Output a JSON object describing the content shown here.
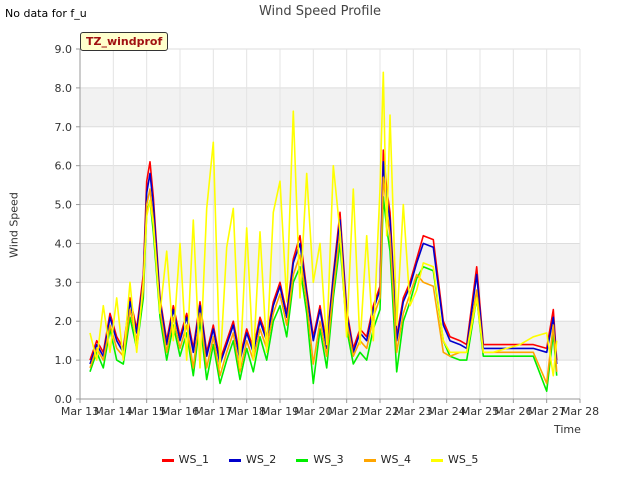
{
  "header": {
    "no_data_note": "No data for f_u",
    "tag_label": "TZ_windprof"
  },
  "chart_data": {
    "type": "line",
    "title": "Wind Speed Profile",
    "xlabel": "Time",
    "ylabel": "Wind Speed",
    "ylim": [
      0,
      9
    ],
    "yticks": [
      "0.0",
      "1.0",
      "2.0",
      "3.0",
      "4.0",
      "5.0",
      "6.0",
      "7.0",
      "8.0",
      "9.0"
    ],
    "xlim": [
      13,
      28
    ],
    "xticks": [
      "Mar 13",
      "Mar 14",
      "Mar 15",
      "Mar 16",
      "Mar 17",
      "Mar 18",
      "Mar 19",
      "Mar 20",
      "Mar 21",
      "Mar 22",
      "Mar 23",
      "Mar 24",
      "Mar 25",
      "Mar 26",
      "Mar 27",
      "Mar 28"
    ],
    "grid": true,
    "legend_position": "bottom",
    "series": [
      {
        "name": "WS_1",
        "color": "#ff0000",
        "x": [
          13.3,
          13.5,
          13.7,
          13.9,
          14.1,
          14.3,
          14.5,
          14.7,
          14.9,
          15.0,
          15.1,
          15.2,
          15.4,
          15.6,
          15.8,
          16.0,
          16.2,
          16.4,
          16.6,
          16.8,
          17.0,
          17.2,
          17.4,
          17.6,
          17.8,
          18.0,
          18.2,
          18.4,
          18.6,
          18.8,
          19.0,
          19.2,
          19.4,
          19.6,
          19.8,
          20.0,
          20.2,
          20.4,
          20.6,
          20.8,
          21.0,
          21.2,
          21.4,
          21.6,
          21.8,
          22.0,
          22.1,
          22.2,
          22.3,
          22.5,
          22.7,
          22.9,
          23.1,
          23.3,
          23.6,
          23.9,
          24.1,
          24.4,
          24.6,
          24.9,
          25.1,
          25.4,
          25.8,
          26.2,
          26.6,
          27.0,
          27.2,
          27.3
        ],
        "y": [
          1.0,
          1.5,
          1.2,
          2.2,
          1.6,
          1.3,
          2.6,
          1.8,
          3.2,
          5.6,
          6.1,
          5.2,
          2.6,
          1.5,
          2.4,
          1.6,
          2.2,
          1.3,
          2.5,
          1.2,
          1.9,
          1.0,
          1.5,
          2.0,
          1.1,
          1.8,
          1.3,
          2.1,
          1.6,
          2.5,
          3.0,
          2.2,
          3.6,
          4.2,
          2.8,
          1.6,
          2.4,
          1.4,
          3.2,
          4.8,
          2.3,
          1.3,
          1.8,
          1.6,
          2.4,
          2.9,
          6.4,
          5.4,
          4.8,
          1.6,
          2.6,
          3.0,
          3.6,
          4.2,
          4.1,
          2.0,
          1.6,
          1.5,
          1.4,
          3.4,
          1.4,
          1.4,
          1.4,
          1.4,
          1.4,
          1.3,
          2.3,
          1.0
        ]
      },
      {
        "name": "WS_2",
        "color": "#0000cc",
        "x": [
          13.3,
          13.5,
          13.7,
          13.9,
          14.1,
          14.3,
          14.5,
          14.7,
          14.9,
          15.0,
          15.1,
          15.2,
          15.4,
          15.6,
          15.8,
          16.0,
          16.2,
          16.4,
          16.6,
          16.8,
          17.0,
          17.2,
          17.4,
          17.6,
          17.8,
          18.0,
          18.2,
          18.4,
          18.6,
          18.8,
          19.0,
          19.2,
          19.4,
          19.6,
          19.8,
          20.0,
          20.2,
          20.4,
          20.6,
          20.8,
          21.0,
          21.2,
          21.4,
          21.6,
          21.8,
          22.0,
          22.1,
          22.2,
          22.3,
          22.5,
          22.7,
          22.9,
          23.1,
          23.3,
          23.6,
          23.9,
          24.1,
          24.4,
          24.6,
          24.9,
          25.1,
          25.4,
          25.8,
          26.2,
          26.6,
          27.0,
          27.2,
          27.3
        ],
        "y": [
          0.9,
          1.4,
          1.1,
          2.1,
          1.5,
          1.2,
          2.5,
          1.7,
          3.0,
          5.3,
          5.8,
          5.0,
          2.5,
          1.4,
          2.3,
          1.5,
          2.1,
          1.2,
          2.4,
          1.1,
          1.8,
          0.9,
          1.4,
          1.9,
          1.0,
          1.7,
          1.2,
          2.0,
          1.5,
          2.4,
          2.9,
          2.1,
          3.5,
          4.0,
          2.7,
          1.5,
          2.3,
          1.3,
          3.1,
          4.6,
          2.2,
          1.2,
          1.7,
          1.5,
          2.3,
          2.8,
          6.1,
          5.2,
          4.6,
          1.5,
          2.5,
          2.9,
          3.5,
          4.0,
          3.9,
          1.9,
          1.5,
          1.4,
          1.3,
          3.2,
          1.3,
          1.3,
          1.3,
          1.3,
          1.3,
          1.2,
          2.1,
          0.9
        ]
      },
      {
        "name": "WS_3",
        "color": "#00ee00",
        "x": [
          13.3,
          13.5,
          13.7,
          13.9,
          14.1,
          14.3,
          14.5,
          14.7,
          14.9,
          15.0,
          15.1,
          15.2,
          15.4,
          15.6,
          15.8,
          16.0,
          16.2,
          16.4,
          16.6,
          16.8,
          17.0,
          17.2,
          17.4,
          17.6,
          17.8,
          18.0,
          18.2,
          18.4,
          18.6,
          18.8,
          19.0,
          19.2,
          19.4,
          19.6,
          19.8,
          20.0,
          20.2,
          20.4,
          20.6,
          20.8,
          21.0,
          21.2,
          21.4,
          21.6,
          21.8,
          22.0,
          22.1,
          22.2,
          22.3,
          22.5,
          22.7,
          22.9,
          23.1,
          23.3,
          23.6,
          23.9,
          24.1,
          24.4,
          24.6,
          24.9,
          25.1,
          25.4,
          25.8,
          26.2,
          26.6,
          27.0,
          27.2,
          27.3
        ],
        "y": [
          0.7,
          1.2,
          0.8,
          1.8,
          1.0,
          0.9,
          2.1,
          1.3,
          2.6,
          4.8,
          5.1,
          4.3,
          2.1,
          1.0,
          1.9,
          1.1,
          1.7,
          0.6,
          2.0,
          0.5,
          1.4,
          0.4,
          1.0,
          1.5,
          0.5,
          1.3,
          0.7,
          1.6,
          1.0,
          2.0,
          2.4,
          1.6,
          3.0,
          3.4,
          2.2,
          0.4,
          1.8,
          0.8,
          2.6,
          4.0,
          1.8,
          0.9,
          1.2,
          1.0,
          1.8,
          2.3,
          5.2,
          4.4,
          3.8,
          0.7,
          2.0,
          2.5,
          3.1,
          3.4,
          3.3,
          1.5,
          1.1,
          1.0,
          1.0,
          2.6,
          1.1,
          1.1,
          1.1,
          1.1,
          1.1,
          0.2,
          1.7,
          0.6
        ]
      },
      {
        "name": "WS_4",
        "color": "#ffa500",
        "x": [
          13.3,
          13.5,
          13.7,
          13.9,
          14.1,
          14.3,
          14.5,
          14.7,
          14.9,
          15.0,
          15.1,
          15.2,
          15.4,
          15.6,
          15.8,
          16.0,
          16.2,
          16.4,
          16.6,
          16.8,
          17.0,
          17.2,
          17.4,
          17.6,
          17.8,
          18.0,
          18.2,
          18.4,
          18.6,
          18.8,
          19.0,
          19.2,
          19.4,
          19.6,
          19.8,
          20.0,
          20.2,
          20.4,
          20.6,
          20.8,
          21.0,
          21.2,
          21.4,
          21.6,
          21.8,
          22.0,
          22.1,
          22.2,
          22.3,
          22.5,
          22.7,
          22.9,
          23.1,
          23.3,
          23.6,
          23.9,
          24.1,
          24.4,
          24.6,
          24.9,
          25.1,
          25.4,
          25.8,
          26.2,
          26.6,
          27.0,
          27.2,
          27.3
        ],
        "y": [
          0.8,
          1.3,
          1.0,
          1.9,
          1.3,
          1.1,
          2.3,
          1.5,
          2.8,
          5.0,
          5.4,
          4.6,
          2.3,
          1.2,
          2.1,
          1.3,
          1.9,
          0.8,
          2.2,
          0.8,
          1.6,
          0.6,
          1.2,
          1.7,
          0.7,
          1.5,
          1.0,
          1.8,
          1.3,
          2.2,
          2.7,
          1.9,
          3.2,
          3.7,
          2.5,
          0.9,
          2.0,
          1.1,
          2.8,
          4.3,
          2.0,
          1.1,
          1.5,
          1.3,
          2.1,
          2.6,
          5.7,
          4.9,
          4.2,
          1.2,
          2.2,
          2.7,
          3.2,
          3.0,
          2.9,
          1.2,
          1.1,
          1.2,
          1.2,
          2.8,
          1.2,
          1.2,
          1.2,
          1.2,
          1.2,
          0.4,
          1.9,
          0.7
        ]
      },
      {
        "name": "WS_5",
        "color": "#ffff00",
        "x": [
          13.3,
          13.5,
          13.7,
          13.9,
          14.1,
          14.3,
          14.5,
          14.7,
          14.9,
          15.0,
          15.1,
          15.2,
          15.4,
          15.6,
          15.8,
          16.0,
          16.2,
          16.4,
          16.6,
          16.8,
          17.0,
          17.2,
          17.4,
          17.6,
          17.8,
          18.0,
          18.2,
          18.4,
          18.6,
          18.8,
          19.0,
          19.2,
          19.4,
          19.6,
          19.8,
          20.0,
          20.2,
          20.4,
          20.6,
          20.8,
          21.0,
          21.2,
          21.4,
          21.6,
          21.8,
          22.0,
          22.1,
          22.2,
          22.3,
          22.5,
          22.7,
          22.9,
          23.1,
          23.3,
          23.6,
          23.9,
          24.1,
          24.4,
          24.6,
          24.9,
          25.1,
          25.4,
          25.8,
          26.2,
          26.6,
          27.0,
          27.2,
          27.3
        ],
        "y": [
          1.7,
          1.0,
          2.4,
          1.2,
          2.6,
          1.0,
          3.0,
          1.2,
          3.0,
          4.7,
          5.1,
          4.5,
          2.2,
          3.8,
          1.5,
          4.0,
          1.0,
          4.6,
          0.8,
          4.9,
          6.6,
          0.8,
          3.9,
          4.9,
          0.8,
          4.4,
          1.0,
          4.3,
          1.2,
          4.8,
          5.6,
          2.5,
          7.4,
          2.6,
          5.8,
          3.0,
          4.0,
          1.4,
          6.0,
          4.3,
          1.6,
          5.4,
          1.4,
          4.2,
          1.5,
          5.4,
          8.4,
          4.2,
          7.3,
          1.9,
          5.0,
          2.4,
          2.8,
          3.5,
          3.4,
          1.5,
          1.2,
          1.2,
          1.2,
          2.6,
          1.2,
          1.2,
          1.3,
          1.4,
          1.6,
          1.7,
          0.6,
          1.5
        ]
      }
    ]
  }
}
